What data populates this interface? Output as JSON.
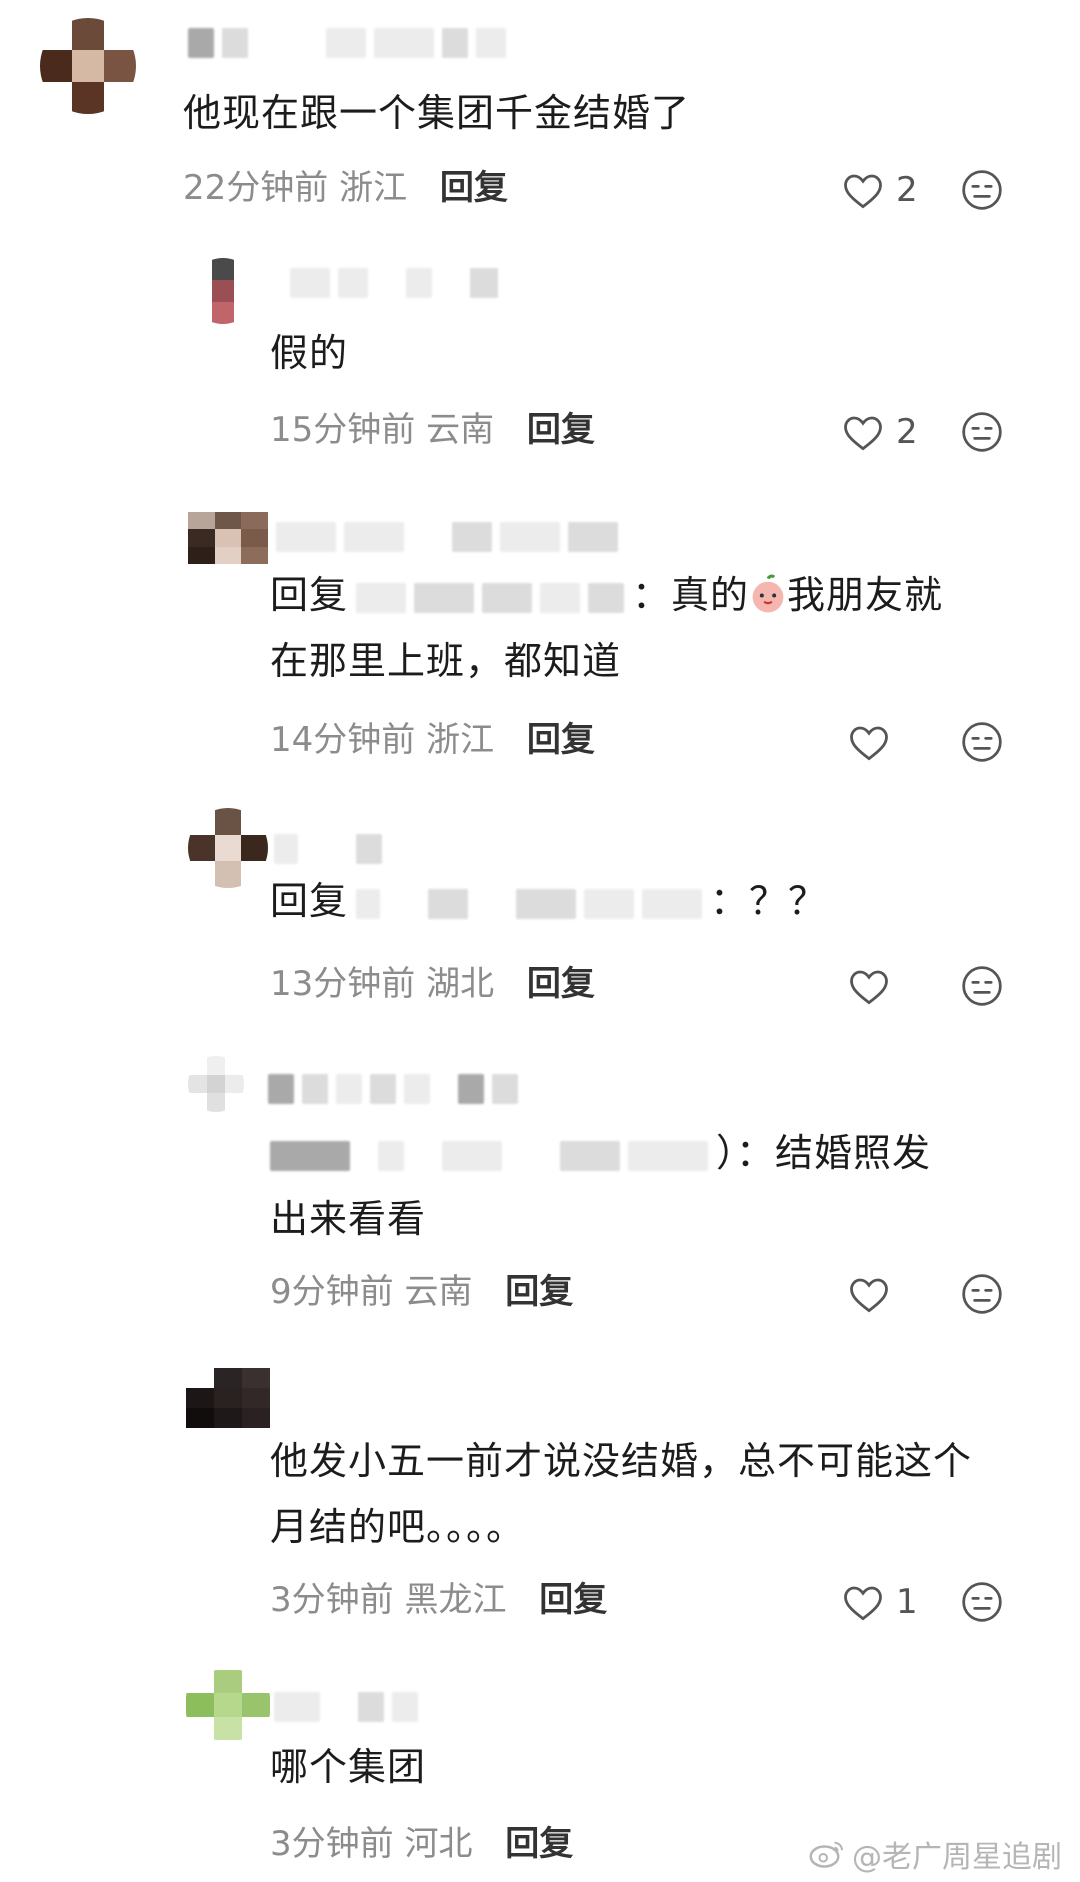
{
  "comments": [
    {
      "text": "他现在跟一个集团千金结婚了",
      "time": "22分钟前",
      "location": "浙江",
      "reply_label": "回复",
      "likes": "2"
    },
    {
      "text": "假的",
      "time": "15分钟前",
      "location": "云南",
      "reply_label": "回复",
      "likes": "2"
    },
    {
      "reply_prefix": "回复",
      "text_before_emoji": "：真的",
      "emoji": "peach-face-emoji",
      "text_after_emoji": "我朋友就",
      "text_line2": "在那里上班，都知道",
      "time": "14分钟前",
      "location": "浙江",
      "reply_label": "回复"
    },
    {
      "reply_prefix": "回复",
      "text": "：？？",
      "time": "13分钟前",
      "location": "湖北",
      "reply_label": "回复"
    },
    {
      "text": "）：结婚照发",
      "text_line2": "出来看看",
      "time": "9分钟前",
      "location": "云南",
      "reply_label": "回复"
    },
    {
      "text": "他发小五一前才说没结婚，总不可能这个",
      "text_line2": "月结的吧。。。。",
      "time": "3分钟前",
      "location": "黑龙江",
      "reply_label": "回复",
      "likes": "1"
    },
    {
      "text": "哪个集团",
      "time": "3分钟前",
      "location": "河北",
      "reply_label": "回复"
    }
  ],
  "watermark": "@老广周星追剧",
  "icons": {
    "like": "heart-outline-icon",
    "dislike": "meh-face-icon",
    "watermark": "weibo-logo-icon"
  },
  "colors": {
    "text": "#1c1c1c",
    "meta": "#8c8c8c",
    "reply": "#333333"
  }
}
